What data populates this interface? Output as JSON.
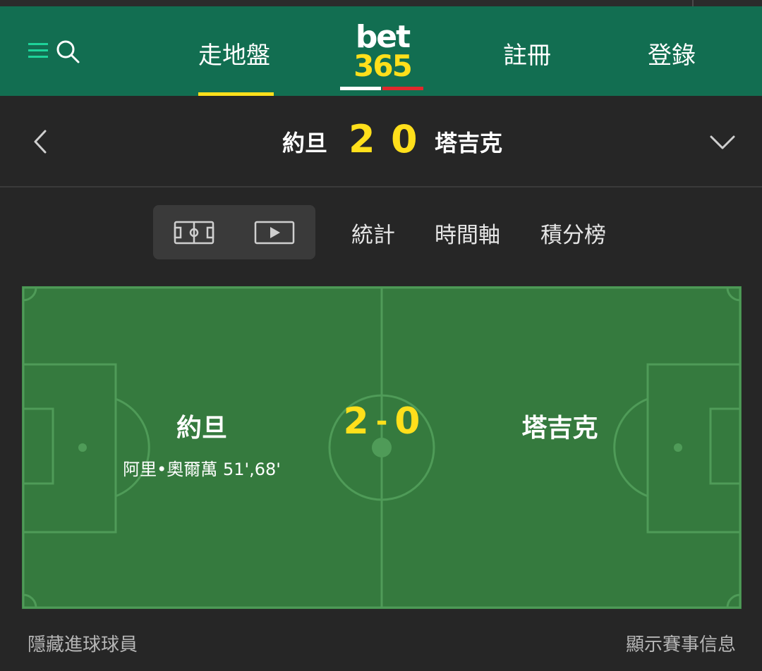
{
  "nav": {
    "menu_icon": "menu-icon",
    "search_icon": "search-icon",
    "inplay_label": "走地盤",
    "logo_top": "bet",
    "logo_bottom": "365",
    "register_label": "註冊",
    "login_label": "登錄"
  },
  "scoreboard": {
    "home_team": "約旦",
    "home_score": "2",
    "away_score": "0",
    "away_team": "塔吉克",
    "home_kit_color": "#ffffff",
    "away_kit_color": "#e0282c",
    "back_icon": "chevron-left-icon",
    "expand_icon": "chevron-down-icon"
  },
  "tabs": {
    "pitch_view_icon": "pitch-icon",
    "video_view_icon": "play-icon",
    "stats": "統計",
    "timeline": "時間軸",
    "standings": "積分榜"
  },
  "pitch": {
    "home_team": "約旦",
    "away_team": "塔吉克",
    "score_home": "2",
    "score_sep": "-",
    "score_away": "0",
    "home_scorer": "阿里•奧爾萬 51',68'"
  },
  "footer": {
    "hide_scorers": "隱藏進球球員",
    "show_info": "顯示賽事信息"
  },
  "colors": {
    "header_green": "#126e51",
    "accent_yellow": "#ffdf1b",
    "pitch_green": "#357a3e",
    "menu_teal": "#1ed39a"
  }
}
